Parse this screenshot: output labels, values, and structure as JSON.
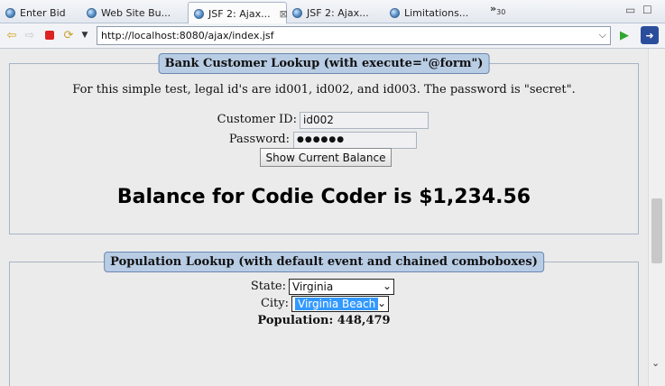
{
  "tabs": [
    {
      "label": "Enter Bid",
      "icon": "globe-icon"
    },
    {
      "label": "Web Site Bu...",
      "icon": "globe-icon"
    },
    {
      "label": "JSF 2: Ajax...",
      "icon": "globe-icon",
      "active": true
    },
    {
      "label": "JSF 2: Ajax...",
      "icon": "globe-icon"
    },
    {
      "label": "Limitations...",
      "icon": "globe-icon"
    }
  ],
  "tab_overflow": {
    "glyph": "»",
    "count": "30"
  },
  "toolbar": {
    "url": "http://localhost:8080/ajax/index.jsf"
  },
  "bank": {
    "legend": "Bank Customer Lookup (with execute=\"@form\")",
    "info": "For this simple test, legal id's are id001, id002, and id003. The password is \"secret\".",
    "customer_id_label": "Customer ID:",
    "customer_id_value": "id002",
    "password_label": "Password:",
    "password_value": "●●●●●●",
    "button_label": "Show Current Balance",
    "balance_text": "Balance for Codie Coder is $1,234.56"
  },
  "population": {
    "legend": "Population Lookup (with default event and chained comboboxes)",
    "state_label": "State:",
    "state_value": "Virginia",
    "city_label": "City:",
    "city_value": "Virginia Beach",
    "population_text": "Population: 448,479"
  },
  "colors": {
    "legend_bg": "#b8cce4",
    "selected_bg": "#3399ff"
  }
}
